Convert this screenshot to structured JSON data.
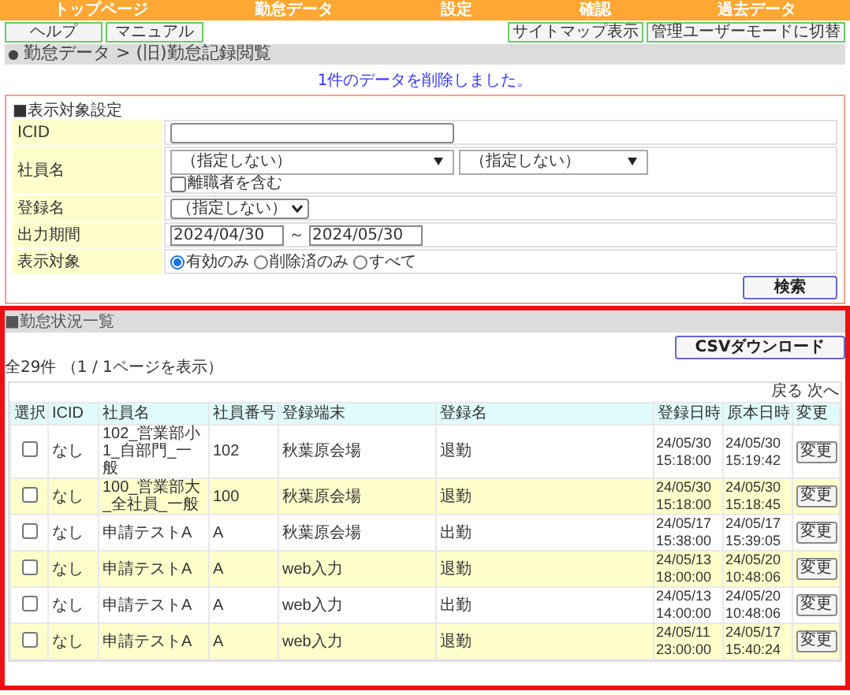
{
  "nav": [
    {
      "label": "トップページ"
    },
    {
      "label": "勤怠データ"
    },
    {
      "label": "設定"
    },
    {
      "label": "確認"
    },
    {
      "label": "過去データ"
    }
  ],
  "left_buttons": [
    "ヘルプ",
    "マニュアル"
  ],
  "right_buttons": [
    "サイトマップ表示",
    "管理ユーザーモードに切替"
  ],
  "breadcrumb": {
    "bullet": "●",
    "text": "勤怠データ > (旧)勤怠記録閲覧"
  },
  "message": "1件のデータを削除しました。",
  "filter": {
    "title": "■表示対象設定",
    "icid": {
      "label": "ICID"
    },
    "employee": {
      "label": "社員名",
      "select_1": "（指定しない）",
      "select_2": "（指定しない）",
      "include_retired": {
        "label": "離職者を含む",
        "checked": false
      }
    },
    "registration": {
      "label": "登録名",
      "value": "（指定しない）"
    },
    "period": {
      "label": "出力期間",
      "from": "2024/04/30",
      "separator": "～",
      "to": "2024/05/30"
    },
    "target": {
      "label": "表示対象",
      "options": [
        {
          "label": "有効のみ",
          "selected": true
        },
        {
          "label": "削除済のみ",
          "selected": false
        },
        {
          "label": "すべて",
          "selected": false
        }
      ]
    },
    "search_button": "検索"
  },
  "list": {
    "title": "■勤怠状況一覧",
    "csv_button": "CSVダウンロード",
    "count": "全29件 （1 / 1ページを表示）",
    "prev": "戻る",
    "next": "次へ",
    "columns": [
      "選択",
      "ICID",
      "社員名",
      "社員番号",
      "登録端末",
      "登録名",
      "登録日時",
      "原本日時",
      "変更"
    ],
    "rows": [
      {
        "checked": false,
        "icid": "なし",
        "name": "102_営業部小1_自部門_一般",
        "number": "102",
        "terminal": "秋葉原会場",
        "type": "退勤",
        "registered": [
          "24/05/30",
          "15:18:00"
        ],
        "original": [
          "24/05/30",
          "15:19:42"
        ],
        "button": "変更"
      },
      {
        "checked": false,
        "icid": "なし",
        "name": "100_営業部大_全社員_一般",
        "number": "100",
        "terminal": "秋葉原会場",
        "type": "退勤",
        "registered": [
          "24/05/30",
          "15:18:00"
        ],
        "original": [
          "24/05/30",
          "15:18:45"
        ],
        "button": "変更"
      },
      {
        "checked": false,
        "icid": "なし",
        "name": "申請テストA",
        "number": "A",
        "terminal": "秋葉原会場",
        "type": "出勤",
        "registered": [
          "24/05/17",
          "15:38:00"
        ],
        "original": [
          "24/05/17",
          "15:39:05"
        ],
        "button": "変更"
      },
      {
        "checked": false,
        "icid": "なし",
        "name": "申請テストA",
        "number": "A",
        "terminal": "web入力",
        "type": "退勤",
        "registered": [
          "24/05/13",
          "18:00:00"
        ],
        "original": [
          "24/05/20",
          "10:48:06"
        ],
        "button": "変更"
      },
      {
        "checked": false,
        "icid": "なし",
        "name": "申請テストA",
        "number": "A",
        "terminal": "web入力",
        "type": "出勤",
        "registered": [
          "24/05/13",
          "14:00:00"
        ],
        "original": [
          "24/05/20",
          "10:48:06"
        ],
        "button": "変更"
      },
      {
        "checked": false,
        "icid": "なし",
        "name": "申請テストA",
        "number": "A",
        "terminal": "web入力",
        "type": "退勤",
        "registered": [
          "24/05/11",
          "23:00:00"
        ],
        "original": [
          "24/05/17",
          "15:40:24"
        ],
        "button": "変更"
      }
    ]
  }
}
